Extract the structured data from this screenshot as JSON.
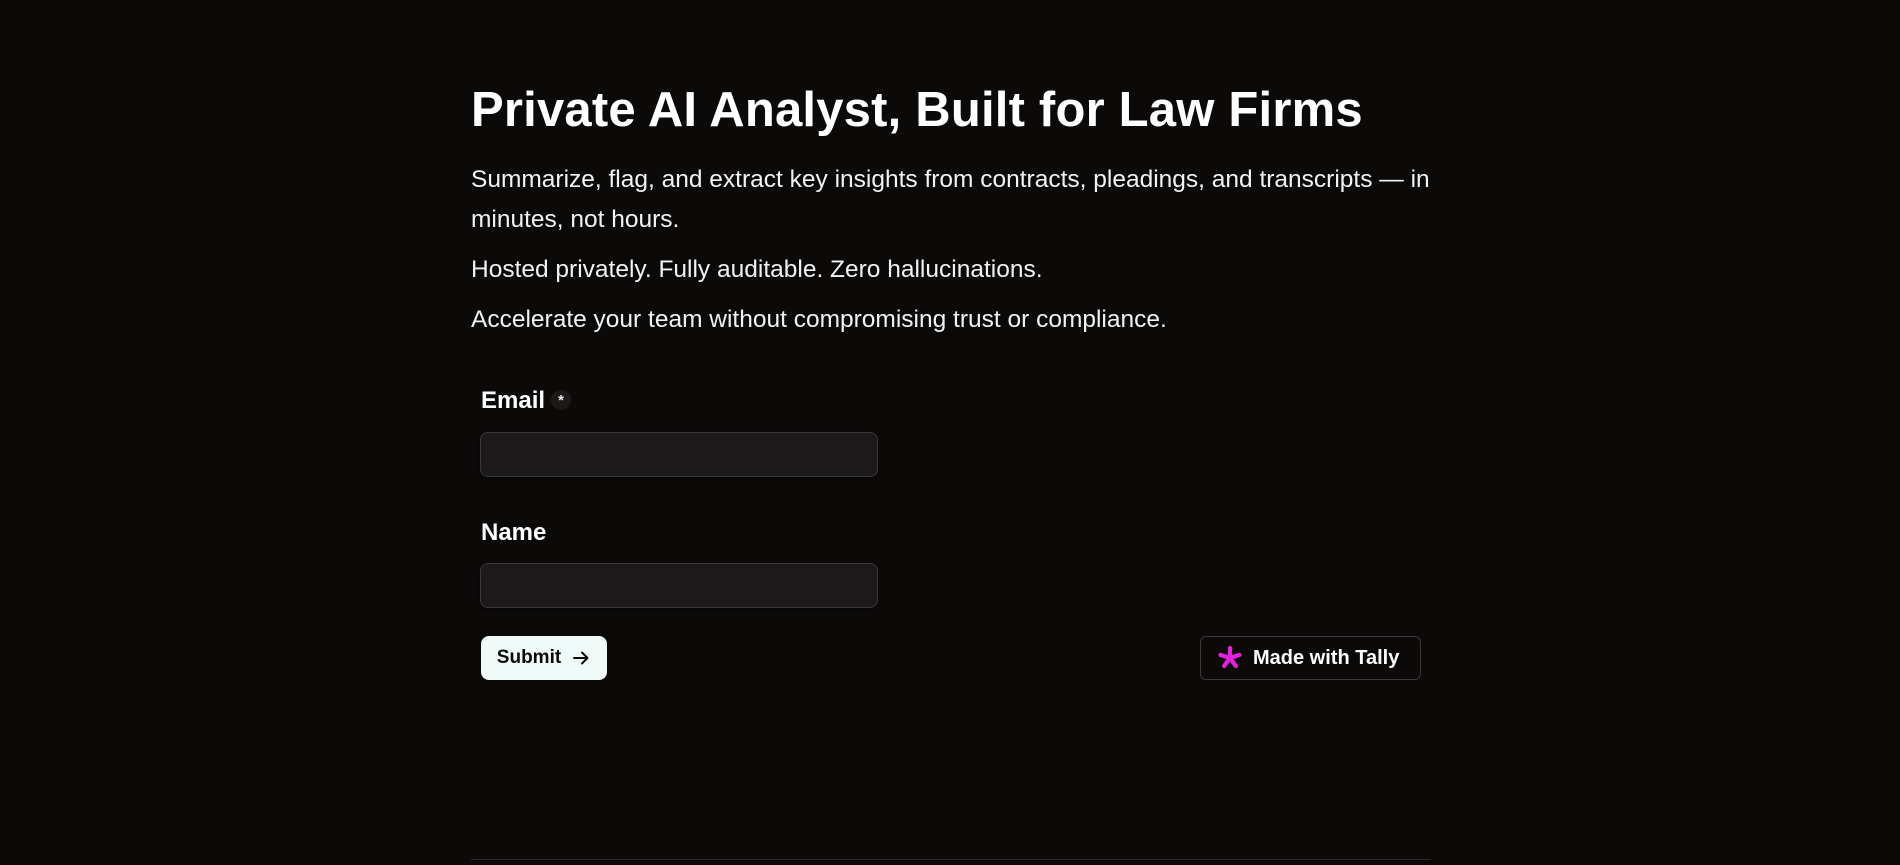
{
  "page": {
    "title": "Private AI Analyst, Built for Law Firms",
    "paragraphs": [
      "Summarize, flag, and extract key insights from contracts, pleadings, and transcripts — in minutes, not hours.",
      "Hosted privately. Fully auditable. Zero hallucinations.",
      "Accelerate your team without compromising trust or compliance."
    ]
  },
  "form": {
    "email": {
      "label": "Email",
      "required_marker": "*",
      "value": "",
      "placeholder": ""
    },
    "name": {
      "label": "Name",
      "value": "",
      "placeholder": ""
    },
    "submit": {
      "label": "Submit",
      "icon": "arrow-right-icon"
    }
  },
  "badge": {
    "label": "Made with Tally",
    "icon": "tally-asterisk-icon",
    "icon_color": "#e91ee3"
  },
  "colors": {
    "background": "#0c0a09",
    "button_bg": "#f0fbf9",
    "input_bg": "#1b191a",
    "accent": "#e91ee3"
  }
}
